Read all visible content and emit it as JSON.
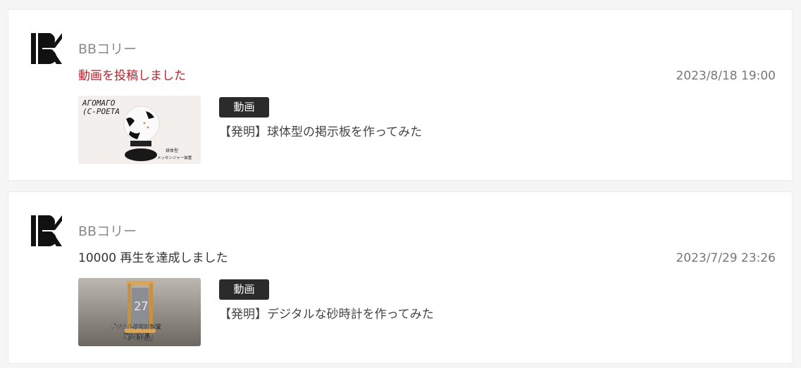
{
  "feed": [
    {
      "channel_name": "BBコリー",
      "activity": "動画を投稿しました",
      "timestamp": "2023/8/18 19:00",
      "badge": "動画",
      "video_title": "【発明】球体型の掲示板を作ってみた",
      "thumb_text": {
        "line_1": "AГOMAГO",
        "line_2": "(C-POETA",
        "caption_1": "球体型",
        "caption_2": "メッセンジャー装置"
      }
    },
    {
      "channel_name": "BBコリー",
      "activity": "10000 再生を達成しました",
      "timestamp": "2023/7/29 23:26",
      "badge": "動画",
      "video_title": "【発明】デジタルな砂時計を作ってみた",
      "thumb_text": {
        "display": "27",
        "caption_1": "デジタル砂時計装置",
        "caption_2": "「砂時場」"
      }
    }
  ],
  "colors": {
    "activity_posted": "#b5232d",
    "badge_bg": "#2b2b2b"
  }
}
